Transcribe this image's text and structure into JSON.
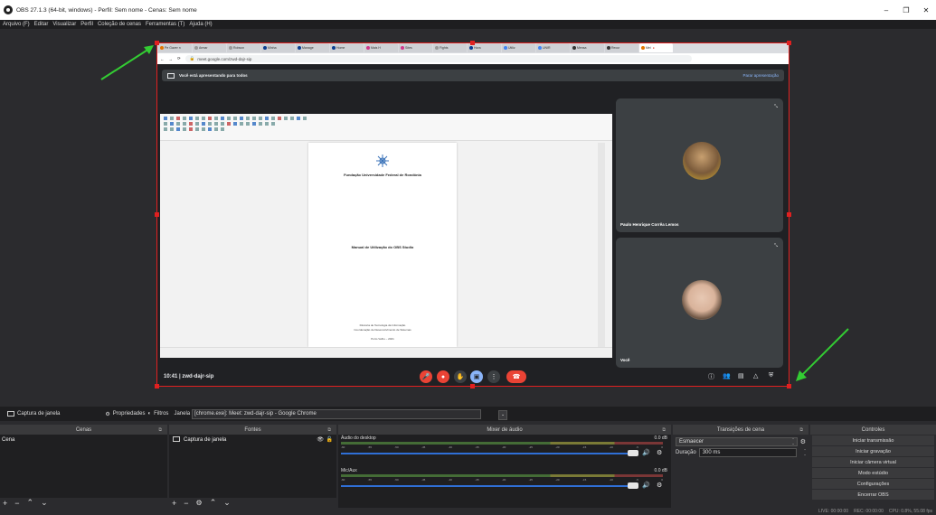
{
  "window": {
    "title": "OBS 27.1.3 (64-bit, windows) - Perfil: Sem nome - Cenas: Sem nome",
    "minimize": "–",
    "maximize": "❐",
    "close": "✕"
  },
  "menu": [
    "Arquivo (F)",
    "Editar",
    "Visualizar",
    "Perfil",
    "Coleção de cenas",
    "Ferramentas (T)",
    "Ajuda (H)"
  ],
  "preview": {
    "browser_tabs": [
      "Pe Gaver n",
      "Armar",
      "Robson",
      "Minha",
      "Manage",
      "Home",
      "Mais H",
      "Sites",
      "Fights",
      "Hora",
      "Utiliz",
      "UNIR",
      "Mensa",
      "Recur",
      "Mei"
    ],
    "address": "meet.google.com/zwd-dajr-sip",
    "meet_banner": "Você está apresentando para todos",
    "stop_presenting": "Parar apresentação",
    "doc_title1": "Fundação Universidade Federal de Rondônia",
    "doc_title2": "Manual de Utilização do OBS Studio",
    "doc_line3": "Diretoria de Tecnologia da Informação",
    "doc_line4": "Coordenação de Desenvolvimento de Sistemas",
    "doc_line5": "Porto Velho – 2021",
    "tile1_name": "Paulo Henrique Corrêa Lemos",
    "tile2_name": "Você",
    "meeting_time": "10:41  |  zwd-dajr-sip"
  },
  "sourcebar": {
    "source_name": "Captura de janela",
    "properties": "Propriedades",
    "filters": "Filtros",
    "window_label": "Janela",
    "window_value": "[chrome.exe]: Meet: zwd-dajr-sip - Google Chrome"
  },
  "docks": {
    "scenes": {
      "title": "Cenas",
      "items": [
        "Cena"
      ]
    },
    "sources": {
      "title": "Fontes",
      "items": [
        "Captura de janela"
      ]
    },
    "mixer": {
      "title": "Mixer de áudio",
      "channels": [
        {
          "name": "Áudio do desktop",
          "db": "0.0 dB"
        },
        {
          "name": "Mic/Aux",
          "db": "0.0 dB"
        }
      ],
      "ticks": [
        "-60",
        "-55",
        "-50",
        "-45",
        "-40",
        "-35",
        "-30",
        "-25",
        "-20",
        "-15",
        "-10",
        "-5",
        "0"
      ]
    },
    "transitions": {
      "title": "Transições de cena",
      "selected": "Esmaecer",
      "duration_label": "Duração",
      "duration_value": "300 ms"
    },
    "controls": {
      "title": "Controles",
      "buttons": [
        "Iniciar transmissão",
        "Iniciar gravação",
        "Iniciar câmera virtual",
        "Modo estúdio",
        "Configurações",
        "Encerrar OBS"
      ]
    }
  },
  "status": {
    "live": "LIVE: 00:00:00",
    "rec": "REC: 00:00:00",
    "cpu": "CPU: 0.8%, 55.08 fps"
  },
  "colors": {
    "selection": "#e02020",
    "arrow": "#33cc33",
    "meet_red": "#ea4335",
    "meet_blue": "#8ab4f8"
  }
}
